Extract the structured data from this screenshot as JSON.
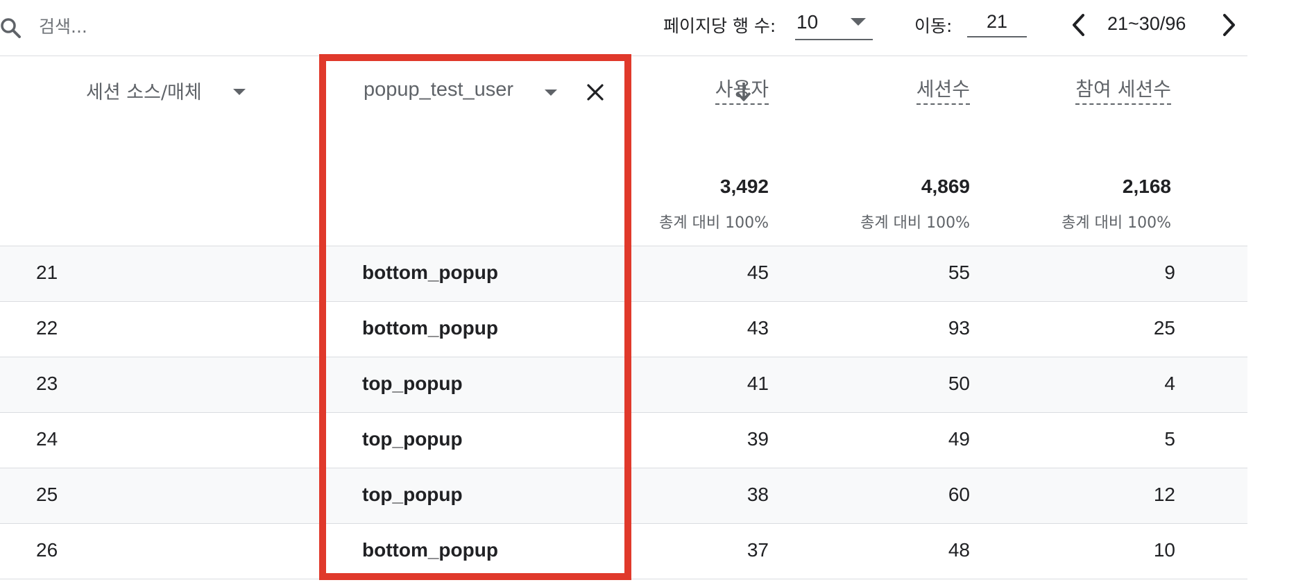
{
  "toolbar": {
    "search_placeholder": "검색...",
    "rows_per_page_label": "페이지당 행 수:",
    "rows_per_page_value": "10",
    "goto_label": "이동:",
    "goto_value": "21",
    "page_range": "21~30/96"
  },
  "header": {
    "dimension1_label": "세션 소스/매체",
    "dimension2_label": "popup_test_user",
    "metrics": [
      {
        "label": "사용자",
        "total": "3,492",
        "pct": "총계 대비 100%",
        "sorted": "descending"
      },
      {
        "label": "세션수",
        "total": "4,869",
        "pct": "총계 대비 100%"
      },
      {
        "label": "참여 세션수",
        "total": "2,168",
        "pct": "총계 대비 100%"
      }
    ]
  },
  "rows": [
    {
      "index": "21",
      "dim": "bottom_popup",
      "users": "45",
      "sessions": "55",
      "engaged": "9"
    },
    {
      "index": "22",
      "dim": "bottom_popup",
      "users": "43",
      "sessions": "93",
      "engaged": "25"
    },
    {
      "index": "23",
      "dim": "top_popup",
      "users": "41",
      "sessions": "50",
      "engaged": "4"
    },
    {
      "index": "24",
      "dim": "top_popup",
      "users": "39",
      "sessions": "49",
      "engaged": "5"
    },
    {
      "index": "25",
      "dim": "top_popup",
      "users": "38",
      "sessions": "60",
      "engaged": "12"
    },
    {
      "index": "26",
      "dim": "bottom_popup",
      "users": "37",
      "sessions": "48",
      "engaged": "10"
    }
  ],
  "colors": {
    "highlight": "#e0392b",
    "row_shade": "#f8f9fa",
    "divider": "#dadce0"
  },
  "icons": [
    "search-icon",
    "chevron-left-icon",
    "chevron-right-icon",
    "close-icon",
    "arrow-down-icon",
    "caret-down-icon"
  ]
}
